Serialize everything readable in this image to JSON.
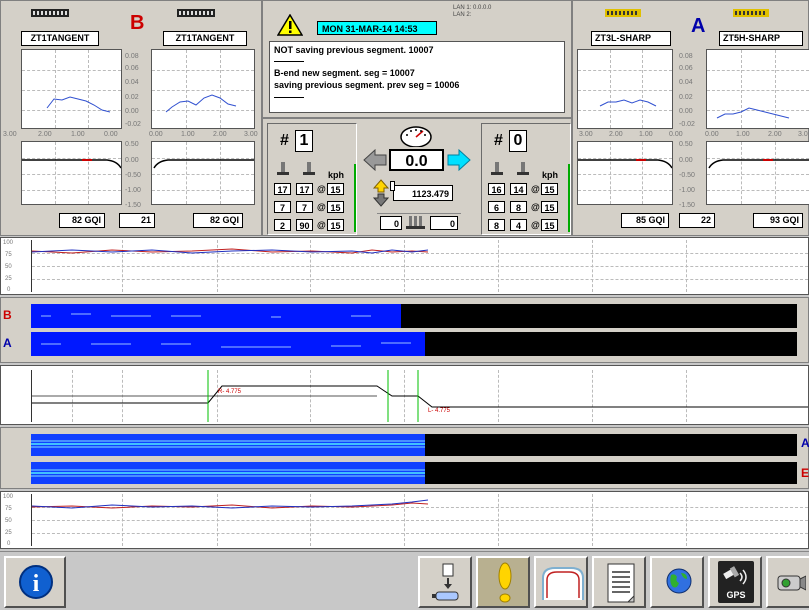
{
  "header": {
    "datetime": "MON 31-MAR-14 14:53",
    "lan1": "LAN 1:  0.0.0.0",
    "lan2": "LAN 2:",
    "messages": [
      "NOT saving previous segment. 10007",
      "B-end new segment. seg = 10007",
      "saving previous segment. prev seg = 10006"
    ]
  },
  "left_panel": {
    "end_letter": "B",
    "left_name": "ZT1TANGENT",
    "right_name": "ZT1TANGENT",
    "right_axis_top": [
      "0.08",
      "0.06",
      "0.04",
      "0.02",
      "0.00",
      "-0.02"
    ],
    "right_axis_bottom": [
      "0.50",
      "0.00",
      "-0.50",
      "-1.00",
      "-1.50"
    ],
    "left_x_ticks": [
      "3.00",
      "2.00",
      "1.00",
      "0.00"
    ],
    "right_x_ticks": [
      "0.00",
      "1.00",
      "2.00",
      "3.00"
    ],
    "gqi_left": "82 GQI",
    "center_value": "21",
    "gqi_right": "82 GQI"
  },
  "right_panel": {
    "end_letter": "A",
    "left_name": "ZT3L-SHARP",
    "right_name": "ZT5H-SHARP",
    "right_axis_top": [
      "0.08",
      "0.06",
      "0.04",
      "0.02",
      "0.00",
      "-0.02"
    ],
    "right_axis_bottom": [
      "0.50",
      "0.00",
      "-0.50",
      "-1.00",
      "-1.50"
    ],
    "left_x_ticks": [
      "3.00",
      "2.00",
      "1.00",
      "0.00"
    ],
    "right_x_ticks": [
      "0.00",
      "1.00",
      "2.00",
      "3.0"
    ],
    "gqi_left": "85 GQI",
    "center_value": "22",
    "gqi_right": "93 GQI"
  },
  "left_counter": {
    "hash": "#",
    "number": "1",
    "kph": "kph",
    "rows": [
      {
        "a": "17",
        "b": "17",
        "at": "@",
        "c": "15"
      },
      {
        "a": "7",
        "b": "7",
        "at": "@",
        "c": "15"
      },
      {
        "a": "2",
        "b": "90",
        "at": "@",
        "c": "15"
      }
    ]
  },
  "right_counter": {
    "hash": "#",
    "number": "0",
    "kph": "kph",
    "rows": [
      {
        "a": "16",
        "b": "14",
        "at": "@",
        "c": "15"
      },
      {
        "a": "6",
        "b": "8",
        "at": "@",
        "c": "15"
      },
      {
        "a": "8",
        "b": "4",
        "at": "@",
        "c": "15"
      }
    ]
  },
  "center": {
    "speed": "0.0",
    "distance": "1123.479",
    "left_count": "0",
    "right_count": "0"
  },
  "strip_axis": [
    "100",
    "75",
    "50",
    "25",
    "0"
  ],
  "bars": {
    "b_label": "B",
    "a_label": "A",
    "right_a_label": "A",
    "right_b_label": "E"
  },
  "curve_labels": {
    "r_label": "R- 4.775",
    "l_label": "L- 4.775"
  },
  "toolbar": {
    "info": "i",
    "items": [
      "usb-transfer",
      "alert",
      "profile",
      "report",
      "globe",
      "gps",
      "camera"
    ],
    "gps_label": "GPS"
  },
  "colors": {
    "accent_cyan": "#00ffff",
    "bar_blue": "#0000ff",
    "bar_black": "#000000",
    "warning_yellow": "#ffff00",
    "end_letter_red": "#cc0000",
    "end_letter_blue": "#0000aa"
  }
}
